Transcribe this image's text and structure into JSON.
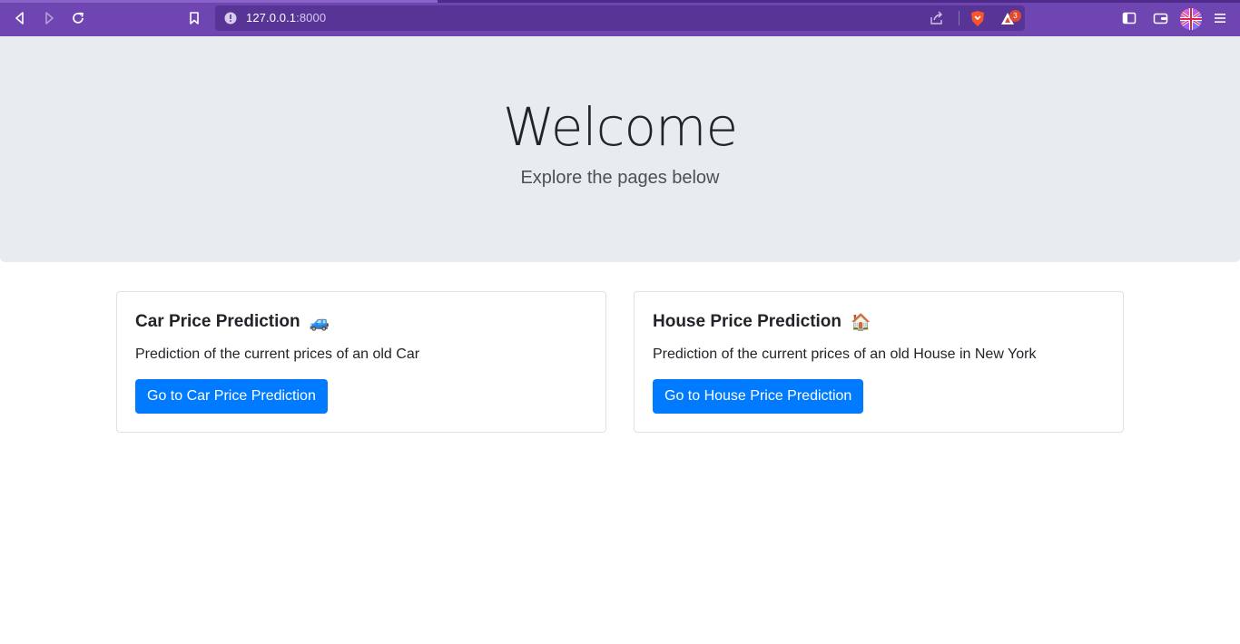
{
  "browser": {
    "url_host": "127.0.0.1",
    "url_port": ":8000",
    "notification_count": "3",
    "icons": {
      "back": "back-arrow-icon",
      "forward": "forward-arrow-icon",
      "reload": "reload-icon",
      "bookmark": "bookmark-icon",
      "site_info": "info-icon",
      "share": "share-icon",
      "brave_shield": "brave-shield-icon",
      "rewards": "rewards-triangle-icon",
      "sidebar": "sidebar-icon",
      "wallet": "wallet-icon",
      "profile": "profile-avatar",
      "menu": "menu-icon"
    },
    "colors": {
      "chrome": "#6f45b2",
      "urlbar": "#573495"
    }
  },
  "hero": {
    "title": "Welcome",
    "subtitle": "Explore the pages below",
    "background": "#e9ecef"
  },
  "cards": [
    {
      "title": "Car Price Prediction",
      "emoji": "🚙",
      "text": "Prediction of the current prices of an old Car",
      "button": "Go to Car Price Prediction"
    },
    {
      "title": "House Price Prediction",
      "emoji": "🏠",
      "text": "Prediction of the current prices of an old House in New York",
      "button": "Go to House Price Prediction"
    }
  ],
  "accent_color": "#007bff"
}
